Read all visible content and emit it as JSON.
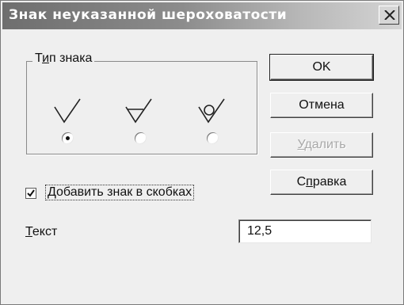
{
  "window": {
    "title": "Знак неуказанной шероховатости"
  },
  "sign_type": {
    "group_label": "Тип знака",
    "options": [
      {
        "symbol": "roughness-check-icon",
        "selected": true
      },
      {
        "symbol": "roughness-triangle-icon",
        "selected": false
      },
      {
        "symbol": "roughness-circle-icon",
        "selected": false
      }
    ]
  },
  "buttons": {
    "ok": "OK",
    "cancel": "Отмена",
    "delete": "Удалить",
    "help": "Справка"
  },
  "options": {
    "add_in_brackets_label": "Добавить знак в скобках",
    "add_in_brackets_checked": true
  },
  "text_field": {
    "label": "Текст",
    "value": "12,5"
  }
}
